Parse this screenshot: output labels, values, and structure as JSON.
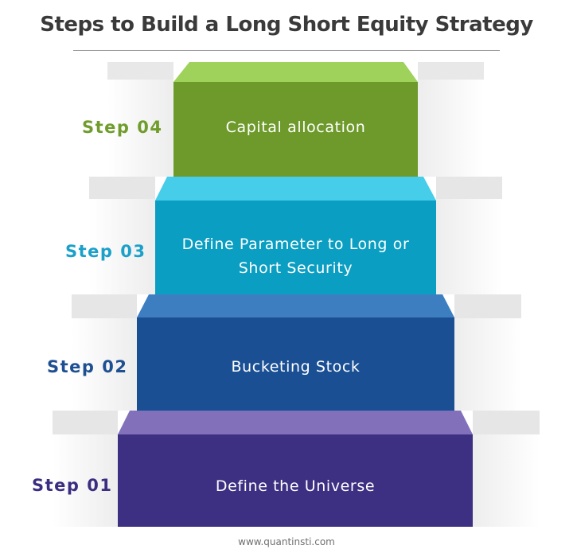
{
  "title": "Steps to Build a Long Short Equity Strategy",
  "steps": [
    {
      "label": "Step 01",
      "text": "Define the Universe",
      "label_color": "#3b2d80",
      "face_color": "#3d2f82",
      "top_color": "#8270bb"
    },
    {
      "label": "Step 02",
      "text": "Bucketing Stock",
      "label_color": "#1d4f91",
      "face_color": "#1a4f94",
      "top_color": "#3d7ec0"
    },
    {
      "label": "Step 03",
      "text": "Define Parameter to Long or Short Security",
      "label_color": "#1aa0c9",
      "face_color": "#0a9ec2",
      "top_color": "#45cde9"
    },
    {
      "label": "Step 04",
      "text": "Capital allocation",
      "label_color": "#6f9c2c",
      "face_color": "#6e9a2b",
      "top_color": "#9ed25a"
    }
  ],
  "footer": "www.quantinsti.com"
}
